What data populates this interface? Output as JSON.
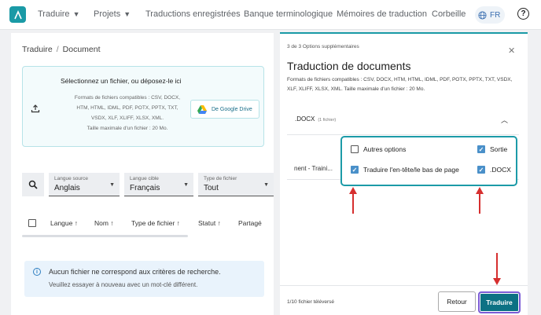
{
  "nav": {
    "items": [
      {
        "label": "Traduire",
        "dropdown": true
      },
      {
        "label": "Projets",
        "dropdown": true
      },
      {
        "label": "Traductions enregistrées",
        "dropdown": false
      },
      {
        "label": "Banque terminologique",
        "dropdown": false
      },
      {
        "label": "Mémoires de traduction",
        "dropdown": false
      },
      {
        "label": "Corbeille",
        "dropdown": false
      }
    ],
    "language": "FR",
    "help": "?"
  },
  "breadcrumb": {
    "root": "Traduire",
    "current": "Document",
    "separator": "/"
  },
  "dropzone": {
    "title": "Sélectionnez un fichier, ou déposez-le ici",
    "formats": "Formats de fichiers compatibles : CSV, DOCX, HTM, HTML, IDML, PDF, POTX, PPTX, TXT, VSDX, XLF, XLIFF, XLSX, XML.",
    "max_size": "Taille maximale d'un fichier : 20 Mo.",
    "gdrive_label": "De Google Drive"
  },
  "filters": {
    "source": {
      "label": "Langue source",
      "value": "Anglais"
    },
    "target": {
      "label": "Langue cible",
      "value": "Français"
    },
    "type": {
      "label": "Type de fichier",
      "value": "Tout"
    }
  },
  "table": {
    "headers": [
      "Langue",
      "Nom",
      "Type de fichier",
      "Statut",
      "Partagé"
    ]
  },
  "notice": {
    "title": "Aucun fichier ne correspond aux critères de recherche.",
    "subtitle": "Veuillez essayer à nouveau avec un mot-clé différent."
  },
  "panel": {
    "options_count": "3 de 3 Options supplémentaires",
    "title": "Traduction de documents",
    "formats": "Formats de fichiers compatibles : CSV, DOCX, HTM, HTML, IDML, PDF, POTX, PPTX, TXT, VSDX, XLF, XLIFF, XLSX, XML. Taille maximale d'un fichier : 20 Mo.",
    "file_type": ".DOCX",
    "file_count": "(1 fichier)",
    "file_name_truncated": "nent - Traini...",
    "options": {
      "other_options": {
        "label": "Autres options",
        "checked": false
      },
      "output": {
        "label": "Sortie",
        "checked": true
      },
      "header_footer": {
        "label": "Traduire l'en-tête/le bas de page",
        "checked": true
      },
      "docx": {
        "label": ".DOCX",
        "checked": true
      }
    },
    "uploaded_text": "1/10 fichier téléversé",
    "back_label": "Retour",
    "translate_label": "Traduire"
  },
  "colors": {
    "accent": "#1a9aa6",
    "primary_button": "#0c7184",
    "annotation_arrow": "#d62f2f",
    "highlight_border": "#7b5cd6"
  }
}
